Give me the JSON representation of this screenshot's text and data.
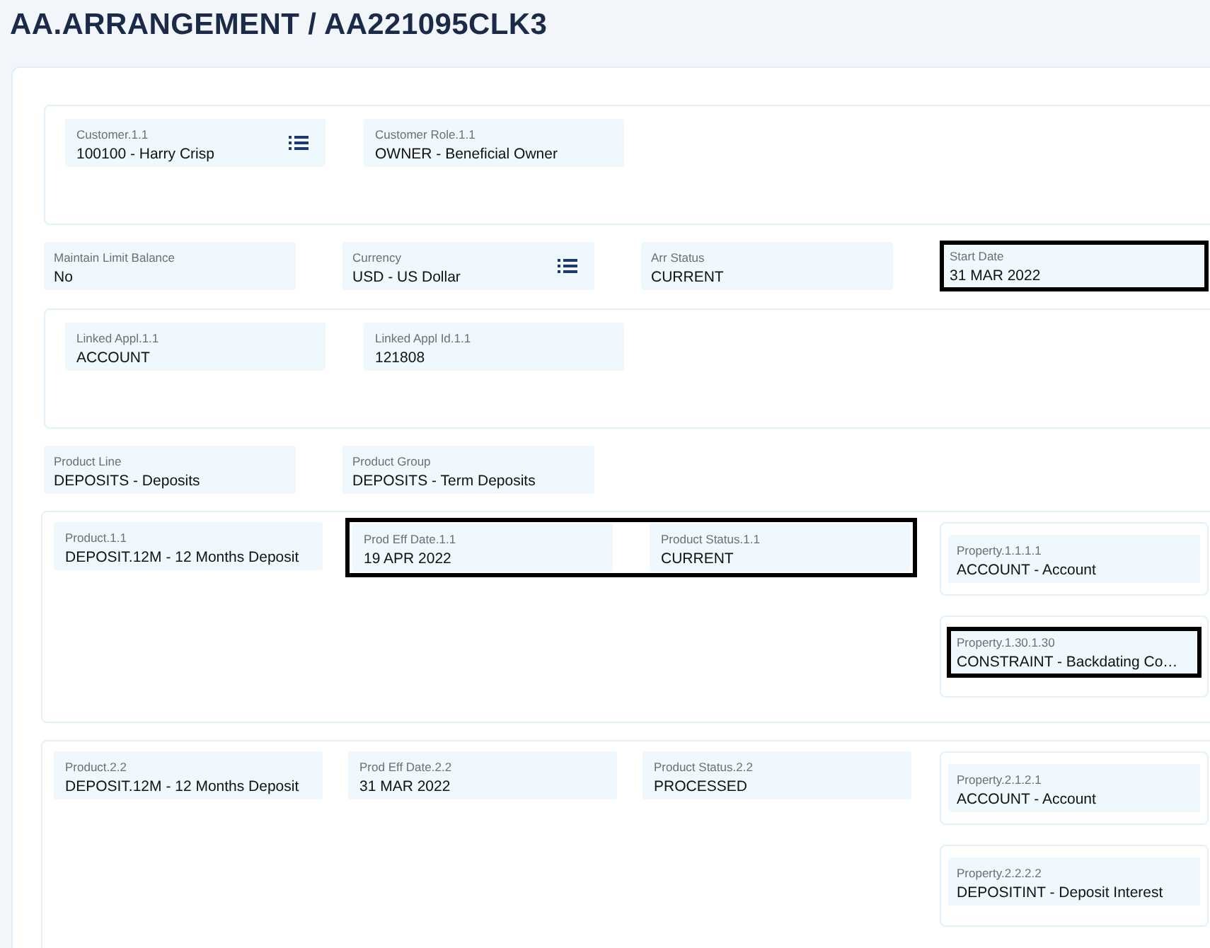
{
  "title": "AA.ARRANGEMENT / AA221095CLK3",
  "sections": [
    {
      "kind": "group",
      "fields": [
        {
          "label": "Customer.1.1",
          "value": "100100 - Harry Crisp",
          "lookup": true,
          "highlighted": false
        },
        {
          "label": "Customer Role.1.1",
          "value": "OWNER - Beneficial Owner",
          "lookup": false,
          "highlighted": false
        }
      ]
    },
    {
      "kind": "row",
      "fields": [
        {
          "label": "Maintain Limit Balance",
          "value": "No",
          "lookup": false,
          "highlighted": false
        },
        {
          "label": "Currency",
          "value": "USD - US Dollar",
          "lookup": true,
          "highlighted": false
        },
        {
          "label": "Arr Status",
          "value": "CURRENT",
          "lookup": false,
          "highlighted": false
        },
        {
          "label": "Start Date",
          "value": "31 MAR 2022",
          "lookup": false,
          "highlighted": true
        }
      ]
    },
    {
      "kind": "group",
      "fields": [
        {
          "label": "Linked Appl.1.1",
          "value": "ACCOUNT",
          "lookup": false,
          "highlighted": false
        },
        {
          "label": "Linked Appl Id.1.1",
          "value": "121808",
          "lookup": false,
          "highlighted": false
        }
      ]
    },
    {
      "kind": "row",
      "fields": [
        {
          "label": "Product Line",
          "value": "DEPOSITS - Deposits",
          "lookup": false,
          "highlighted": false
        },
        {
          "label": "Product Group",
          "value": "DEPOSITS - Term Deposits",
          "lookup": false,
          "highlighted": false
        }
      ]
    }
  ],
  "products": [
    {
      "items": [
        {
          "kind": "field",
          "fields": [
            {
              "label": "Product.1.1",
              "value": "DEPOSIT.12M - 12 Months Deposit"
            }
          ]
        },
        {
          "kind": "highlight",
          "fields": [
            {
              "label": "Prod Eff Date.1.1",
              "value": "19 APR 2022"
            },
            {
              "label": "Product Status.1.1",
              "value": "CURRENT"
            }
          ]
        }
      ],
      "properties": [
        {
          "label": "Property.1.1.1.1",
          "value": "ACCOUNT - Account",
          "highlighted": false
        },
        {
          "label": "Property.1.30.1.30",
          "value": "CONSTRAINT - Backdating Co…",
          "highlighted": true
        }
      ]
    },
    {
      "items": [
        {
          "kind": "field",
          "fields": [
            {
              "label": "Product.2.2",
              "value": "DEPOSIT.12M - 12 Months Deposit"
            }
          ]
        },
        {
          "kind": "field",
          "fields": [
            {
              "label": "Prod Eff Date.2.2",
              "value": "31 MAR 2022"
            }
          ]
        },
        {
          "kind": "field",
          "fields": [
            {
              "label": "Product Status.2.2",
              "value": "PROCESSED"
            }
          ]
        }
      ],
      "properties": [
        {
          "label": "Property.2.1.2.1",
          "value": "ACCOUNT - Account",
          "highlighted": false
        },
        {
          "label": "Property.2.2.2.2",
          "value": "DEPOSITINT - Deposit Interest",
          "highlighted": false
        }
      ]
    }
  ]
}
